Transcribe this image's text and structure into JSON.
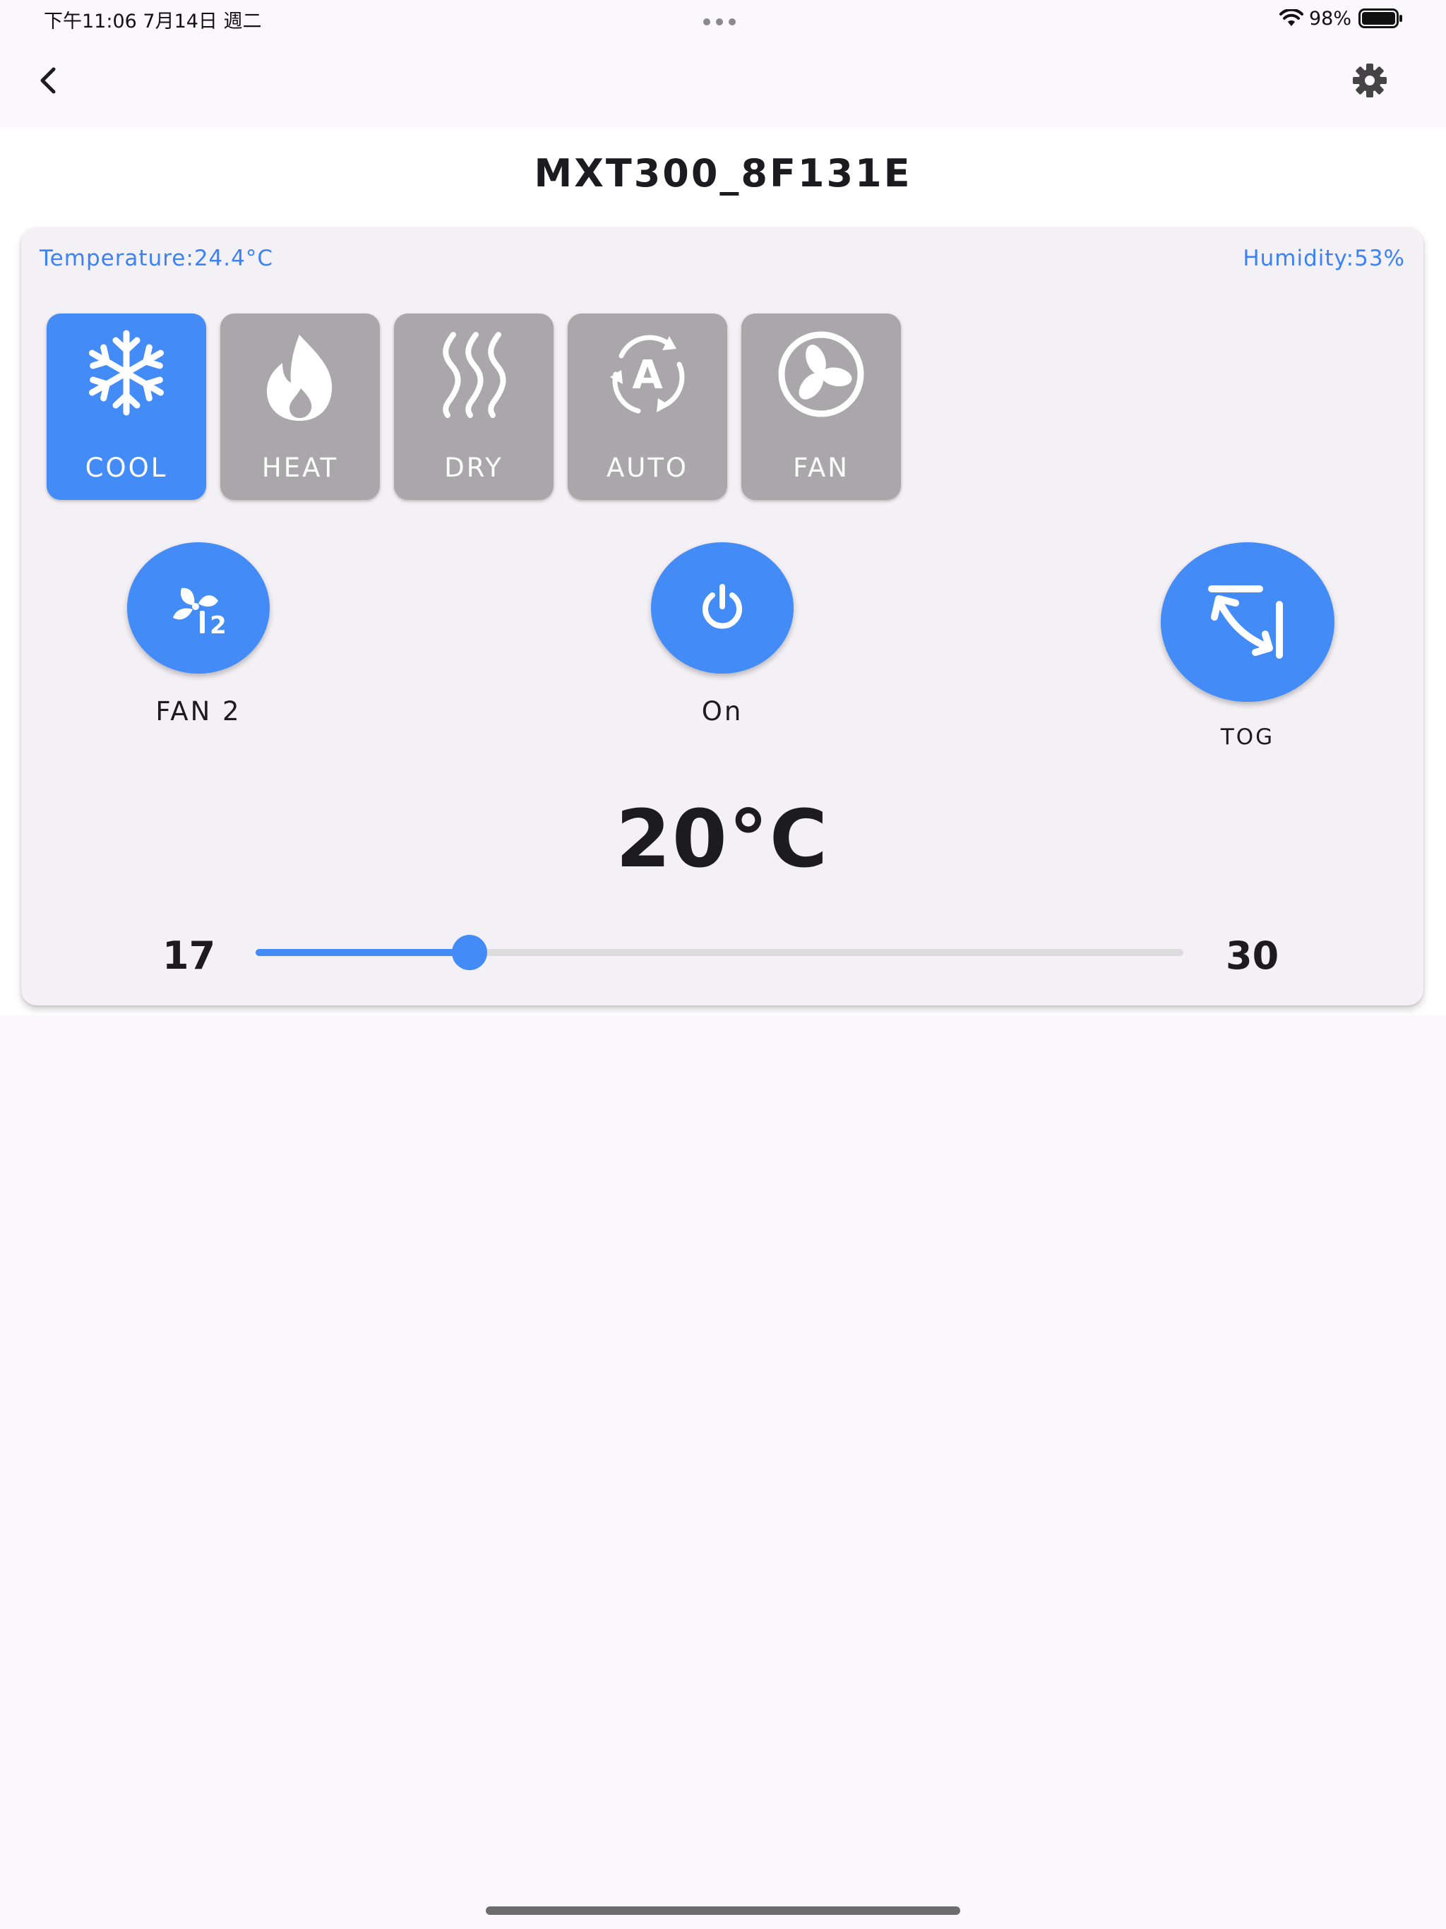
{
  "status_bar": {
    "time_date": "下午11:06   7月14日 週二",
    "battery_percent": "98%"
  },
  "header": {
    "title": "MXT300_8F131E"
  },
  "readings": {
    "temperature": "Temperature:24.4°C",
    "humidity": "Humidity:53%"
  },
  "modes": [
    {
      "label": "COOL",
      "icon": "snowflake-icon",
      "active": true
    },
    {
      "label": "HEAT",
      "icon": "flame-icon",
      "active": false
    },
    {
      "label": "DRY",
      "icon": "heat-waves-icon",
      "active": false
    },
    {
      "label": "AUTO",
      "icon": "auto-cycle-icon",
      "active": false
    },
    {
      "label": "FAN",
      "icon": "fan-icon",
      "active": false
    }
  ],
  "controls": {
    "fan_label": "FAN 2",
    "power_label": "On",
    "swing_label": "TOG"
  },
  "setpoint": {
    "display": "20°C",
    "value": 20,
    "min": 17,
    "max": 30,
    "min_label": "17",
    "max_label": "30"
  },
  "colors": {
    "accent": "#438bf7",
    "inactive_mode": "#a9a7aa",
    "reading_text": "#3b82f6"
  }
}
